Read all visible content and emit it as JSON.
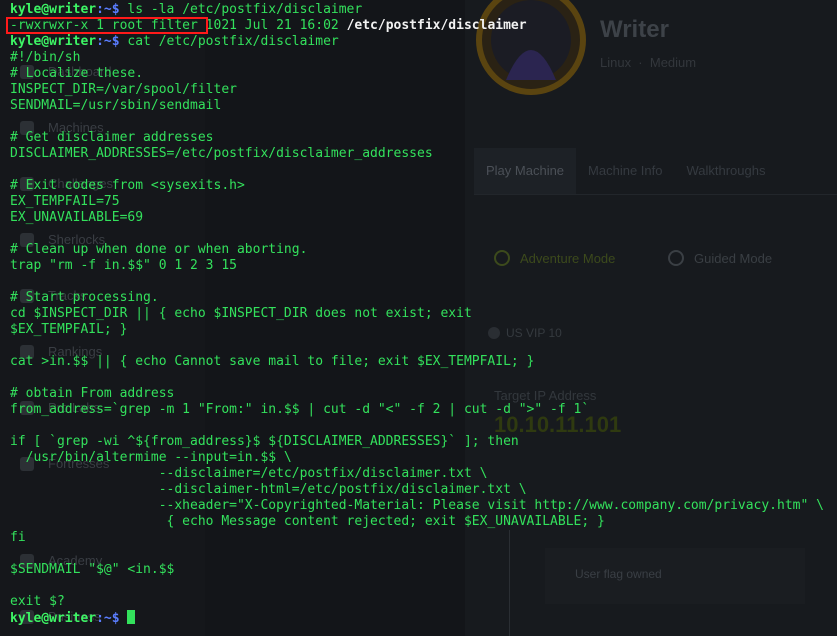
{
  "background_page": {
    "nav": [
      "Dashboard",
      "Machines",
      "Challenges",
      "Sherlocks",
      "Tracks",
      "Rankings",
      "Pro Labs",
      "Fortresses",
      "Academy",
      "Business"
    ],
    "machine": {
      "name": "Writer",
      "os": "Linux",
      "difficulty": "Medium"
    },
    "tabs": [
      "Play Machine",
      "Machine Info",
      "Walkthroughs"
    ],
    "modes": {
      "adventure": "Adventure Mode",
      "guided": "Guided Mode"
    },
    "vpn": "US VIP 10",
    "target_ip_label": "Target IP Address",
    "target_ip": "10.10.11.101",
    "user_flag": "User flag owned",
    "colors": {
      "accent": "#9fef00",
      "bg": "#131519"
    }
  },
  "terminal": {
    "prompt_user": "kyle@writer",
    "prompt_path": ":~$",
    "cmd1": " ls -la /etc/postfix/disclaimer",
    "ls_perms": "-rwxrwxr-x 1 root filter",
    "ls_meta": " 1021 Jul 21 16:02 ",
    "ls_file": "/etc/postfix/disclaimer",
    "cmd2": " cat /etc/postfix/disclaimer",
    "file_lines": [
      "#!/bin/sh",
      "# Localize these.",
      "INSPECT_DIR=/var/spool/filter",
      "SENDMAIL=/usr/sbin/sendmail",
      "",
      "# Get disclaimer addresses",
      "DISCLAIMER_ADDRESSES=/etc/postfix/disclaimer_addresses",
      "",
      "# Exit codes from <sysexits.h>",
      "EX_TEMPFAIL=75",
      "EX_UNAVAILABLE=69",
      "",
      "# Clean up when done or when aborting.",
      "trap \"rm -f in.$$\" 0 1 2 3 15",
      "",
      "# Start processing.",
      "cd $INSPECT_DIR || { echo $INSPECT_DIR does not exist; exit",
      "$EX_TEMPFAIL; }",
      "",
      "cat >in.$$ || { echo Cannot save mail to file; exit $EX_TEMPFAIL; }",
      "",
      "# obtain From address",
      "from_address=`grep -m 1 \"From:\" in.$$ | cut -d \"<\" -f 2 | cut -d \">\" -f 1`",
      "",
      "if [ `grep -wi ^${from_address}$ ${DISCLAIMER_ADDRESSES}` ]; then",
      "  /usr/bin/altermime --input=in.$$ \\",
      "                   --disclaimer=/etc/postfix/disclaimer.txt \\",
      "                   --disclaimer-html=/etc/postfix/disclaimer.txt \\",
      "                   --xheader=\"X-Copyrighted-Material: Please visit http://www.company.com/privacy.htm\" \\",
      "                    { echo Message content rejected; exit $EX_UNAVAILABLE; }",
      "fi",
      "$SENDMAIL \"$@\" <in.$$",
      "",
      "exit $?"
    ],
    "colors": {
      "text": "#33e15c",
      "user": "#3df565",
      "path": "#5a7dff",
      "highlight_box": "#ff1a1a"
    }
  }
}
